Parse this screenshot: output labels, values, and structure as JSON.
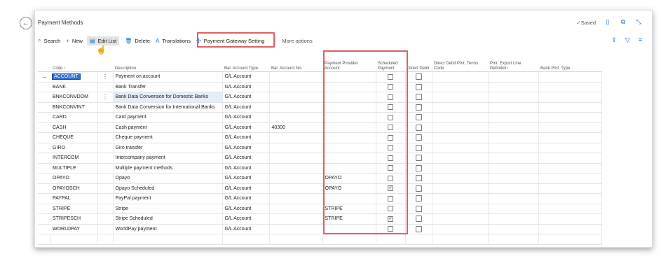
{
  "page": {
    "title": "Payment Methods",
    "saved_label": "Saved"
  },
  "toolbar": {
    "search_label": "Search",
    "new_label": "New",
    "edit_list_label": "Edit List",
    "delete_label": "Delete",
    "translations_label": "Translations",
    "payment_gateway_label": "Payment Gateway Setting",
    "more_options_label": "More options"
  },
  "columns": {
    "code": "Code ↑",
    "description": "Description",
    "bal_account_type": "Bal. Account Type",
    "bal_account_no": "Bal. Account No.",
    "payment_provider_account": "Payment Provider Account",
    "scheduled_payment": "Scheduled Payment",
    "direct_debit": "Direct Debit",
    "direct_debit_terms": "Direct Debit Pmt. Terms Code",
    "pmt_export": "Pmt. Export Line Definition",
    "bank_pmt_type": "Bank Pmt. Type"
  },
  "rows": [
    {
      "code": "ACCOUNT",
      "description": "Payment on account",
      "bal_type": "G/L Account",
      "bal_no": "",
      "provider": "",
      "scheduled": false
    },
    {
      "code": "BANK",
      "description": "Bank Transfer",
      "bal_type": "G/L Account",
      "bal_no": "",
      "provider": "",
      "scheduled": false
    },
    {
      "code": "BNKCONVDOM",
      "description": "Bank Data Conversion for Domestic Banks",
      "bal_type": "G/L Account",
      "bal_no": "",
      "provider": "",
      "scheduled": false
    },
    {
      "code": "BNKCONVINT",
      "description": "Bank Data Conversion for International Banks",
      "bal_type": "G/L Account",
      "bal_no": "",
      "provider": "",
      "scheduled": false
    },
    {
      "code": "CARD",
      "description": "Card payment",
      "bal_type": "G/L Account",
      "bal_no": "",
      "provider": "",
      "scheduled": false
    },
    {
      "code": "CASH",
      "description": "Cash payment",
      "bal_type": "G/L Account",
      "bal_no": "40300",
      "provider": "",
      "scheduled": false
    },
    {
      "code": "CHEQUE",
      "description": "Cheque payment",
      "bal_type": "G/L Account",
      "bal_no": "",
      "provider": "",
      "scheduled": false
    },
    {
      "code": "GIRO",
      "description": "Giro transfer",
      "bal_type": "G/L Account",
      "bal_no": "",
      "provider": "",
      "scheduled": false
    },
    {
      "code": "INTERCOM",
      "description": "Intercompany payment",
      "bal_type": "G/L Account",
      "bal_no": "",
      "provider": "",
      "scheduled": false
    },
    {
      "code": "MULTIPLE",
      "description": "Multiple payment methods",
      "bal_type": "G/L Account",
      "bal_no": "",
      "provider": "",
      "scheduled": false
    },
    {
      "code": "OPAYO",
      "description": "Opayo",
      "bal_type": "G/L Account",
      "bal_no": "",
      "provider": "OPAYO",
      "scheduled": false
    },
    {
      "code": "OPAYOSCH",
      "description": "Opayo Scheduled",
      "bal_type": "G/L Account",
      "bal_no": "",
      "provider": "OPAYO",
      "scheduled": true
    },
    {
      "code": "PAYPAL",
      "description": "PayPal payment",
      "bal_type": "G/L Account",
      "bal_no": "",
      "provider": "",
      "scheduled": false
    },
    {
      "code": "STRIPE",
      "description": "Stripe",
      "bal_type": "G/L Account",
      "bal_no": "",
      "provider": "STRIPE",
      "scheduled": false
    },
    {
      "code": "STRIPESCH",
      "description": "Stripe Scheduled",
      "bal_type": "G/L Account",
      "bal_no": "",
      "provider": "STRIPE",
      "scheduled": true
    },
    {
      "code": "WORLDPAY",
      "description": "WorldPay payment",
      "bal_type": "G/L Account",
      "bal_no": "",
      "provider": "",
      "scheduled": false
    }
  ],
  "icons": {
    "back": "arrow-left-icon",
    "search": "search-icon",
    "new": "plus-icon",
    "edit_list": "edit-list-icon",
    "delete": "trash-icon",
    "translations": "translate-icon",
    "gateway": "gateway-icon",
    "bookmark": "bookmark-icon",
    "open_new": "open-in-new-icon",
    "collapse": "collapse-icon",
    "share": "share-icon",
    "filter": "filter-icon",
    "list_view": "list-view-icon"
  },
  "colors": {
    "accent": "#0f6fc6",
    "highlight": "#e06060",
    "selected_code_bg": "#2e6fcf"
  }
}
